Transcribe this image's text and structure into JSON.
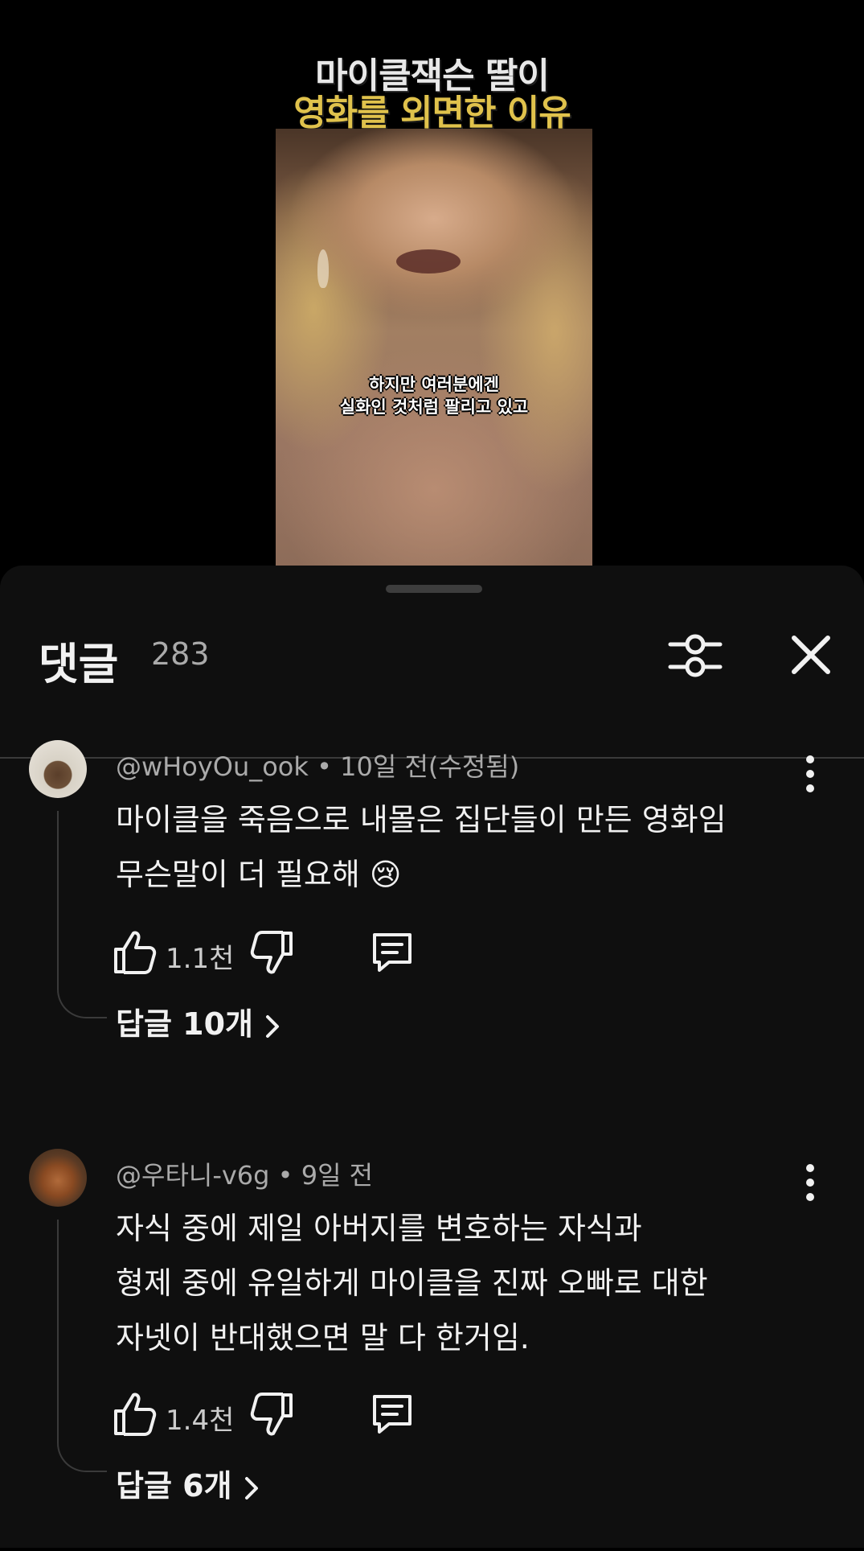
{
  "video": {
    "title_line1": "마이클잭슨 딸이",
    "title_line2": "영화를 외면한 이유",
    "subtitle_line1": "하지만 여러분에겐",
    "subtitle_line2": "실화인 것처럼 팔리고 있고",
    "title_accent_color": "#e0c24c"
  },
  "sheet": {
    "title": "댓글",
    "count": "283",
    "icons": [
      "filter-icon",
      "close-icon"
    ]
  },
  "comments": [
    {
      "author": "@wHoyOu_ook",
      "time": "10일 전(수정됨)",
      "lines": [
        "마이클을 죽음으로 내몰은 집단들이 만든 영화임",
        "무슨말이 더 필요해 😢"
      ],
      "likes": "1.1천",
      "replies_label": "답글 10개"
    },
    {
      "author": "@우타니-v6g",
      "time": "9일 전",
      "lines": [
        "자식 중에 제일 아버지를 변호하는 자식과",
        "형제 중에 유일하게 마이클을 진짜 오빠로 대한",
        "자넷이 반대했으면 말 다 한거임."
      ],
      "likes": "1.4천",
      "replies_label": "답글 6개"
    }
  ],
  "meta_separator": " • "
}
